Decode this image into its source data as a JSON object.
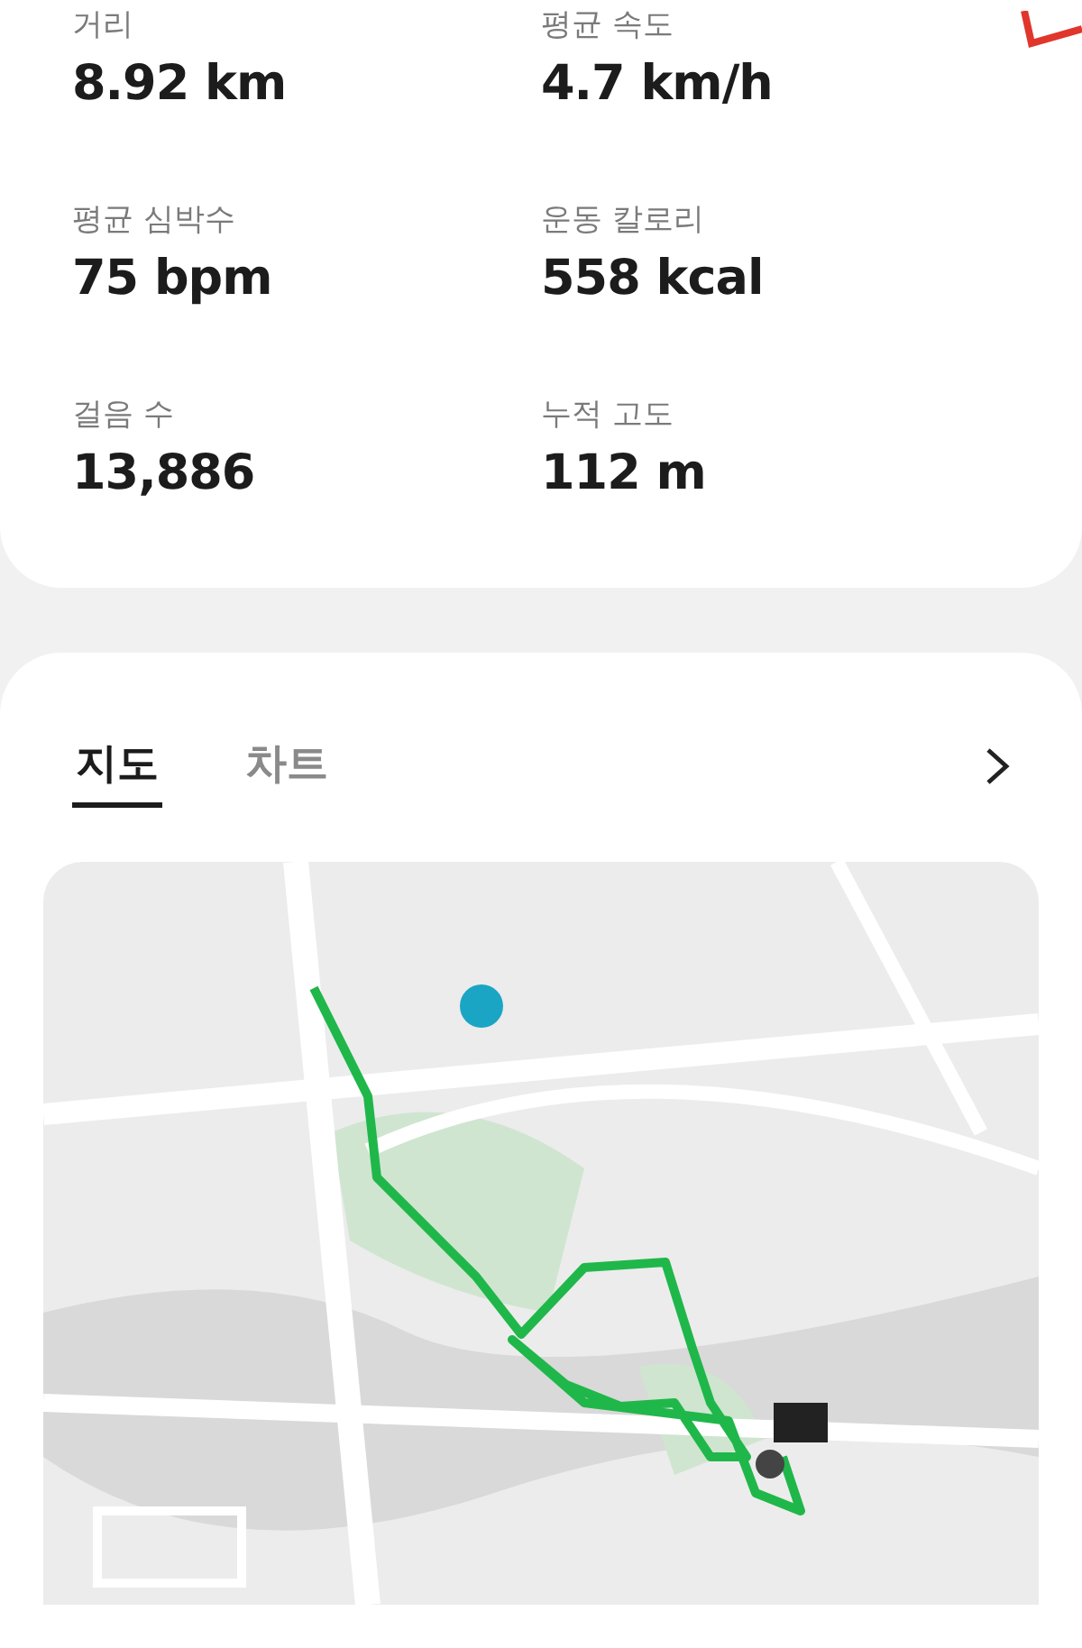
{
  "stats": [
    {
      "label": "거리",
      "value": "8.92 km"
    },
    {
      "label": "평균 속도",
      "value": "4.7 km/h"
    },
    {
      "label": "평균 심박수",
      "value": "75 bpm"
    },
    {
      "label": "운동 칼로리",
      "value": "558 kcal"
    },
    {
      "label": "걸음 수",
      "value": "13,886"
    },
    {
      "label": "누적 고도",
      "value": "112 m"
    }
  ],
  "tabs": [
    {
      "label": "지도",
      "selected": true
    },
    {
      "label": "차트",
      "selected": false
    }
  ]
}
